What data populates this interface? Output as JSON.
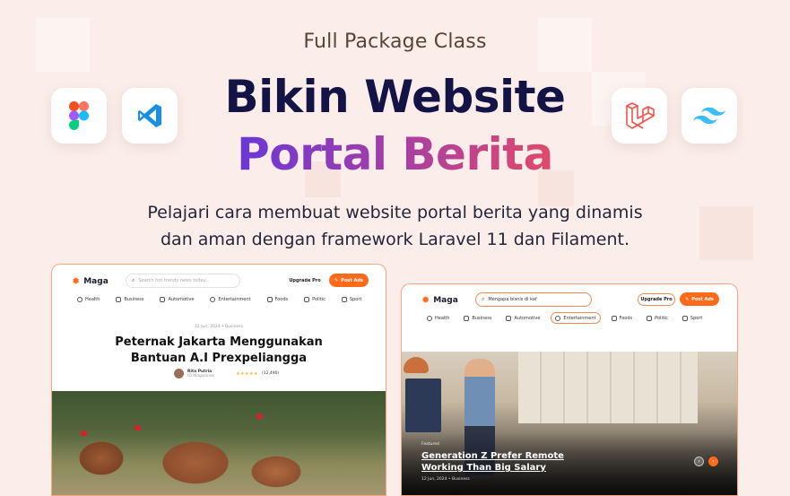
{
  "hero": {
    "kicker": "Full Package Class",
    "title_line1": "Bikin Website",
    "title_line2": "Portal Berita",
    "description_line1": "Pelajari cara membuat website portal berita yang dinamis",
    "description_line2": "dan aman dengan framework Laravel 11 dan Filament."
  },
  "tools": [
    "figma-icon",
    "vscode-icon",
    "laravel-icon",
    "tailwind-icon"
  ],
  "colors": {
    "accent": "#ff6b1a",
    "headline": "#131346",
    "gradient_start": "#6a38d6",
    "gradient_end": "#e04a6a"
  },
  "mock_left": {
    "logo": "Maga",
    "search_placeholder": "Search hot trendy news today...",
    "upgrade_label": "Upgrade Pro",
    "post_label": "Post Ads",
    "categories": [
      "Health",
      "Business",
      "Automotive",
      "Entertainment",
      "Foods",
      "Politic",
      "Sport"
    ],
    "article_meta": "12 Jun, 2024 • Business",
    "article_title_line1": "Peternak Jakarta Menggunakan",
    "article_title_line2": "Bantuan A.I Prexpeliangga",
    "author_name": "Rita Putria",
    "author_role": "ID Magazines",
    "rating": "★★★★★",
    "rating_count": "(12,490)"
  },
  "mock_right": {
    "logo": "Maga",
    "search_value": "Mengapa bisnis di kaf",
    "upgrade_label": "Upgrade Pro",
    "post_label": "Post Ads",
    "categories": [
      "Health",
      "Business",
      "Automotive",
      "Entertainment",
      "Foods",
      "Politic",
      "Sport"
    ],
    "active_category": "Entertainment",
    "featured_tag": "Featured",
    "featured_title_line1": "Generation Z Prefer Remote",
    "featured_title_line2": "Working Than Big Salary",
    "featured_meta": "12 Jun, 2024 • Business"
  }
}
